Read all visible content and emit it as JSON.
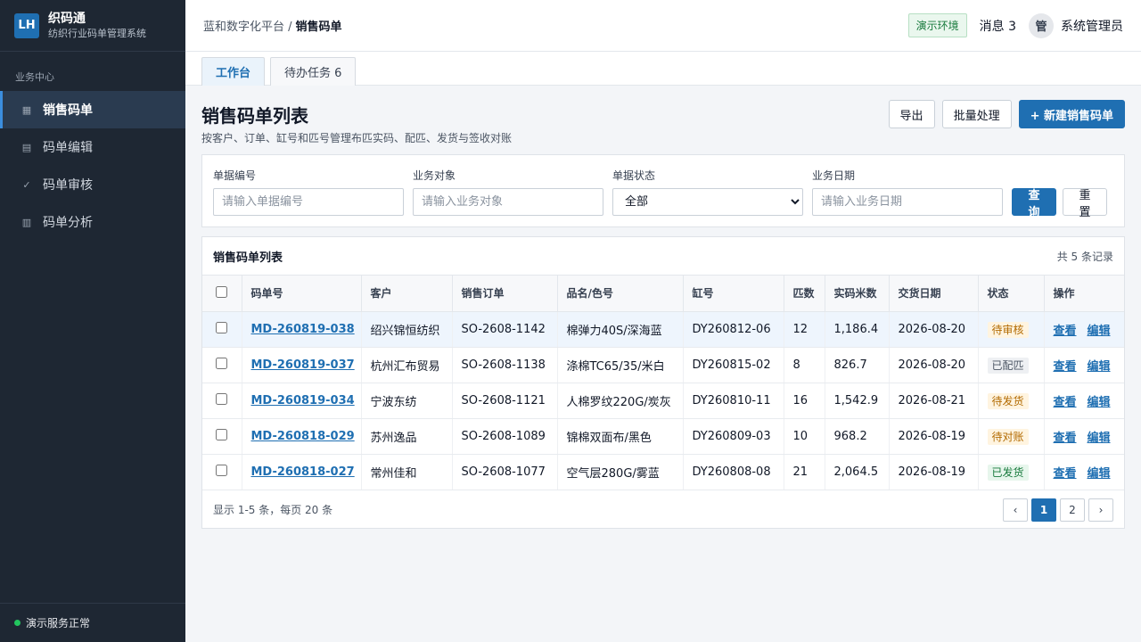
{
  "brand": {
    "logo": "LH",
    "name": "织码通",
    "subtitle": "纺织行业码单管理系统"
  },
  "sidebar": {
    "section": "业务中心",
    "items": [
      {
        "label": "销售码单",
        "icon": "grid-icon",
        "glyph": "▦",
        "active": true
      },
      {
        "label": "码单编辑",
        "icon": "edit-list-icon",
        "glyph": "▤",
        "active": false
      },
      {
        "label": "码单审核",
        "icon": "check-icon",
        "glyph": "✓",
        "active": false
      },
      {
        "label": "码单分析",
        "icon": "chart-icon",
        "glyph": "▥",
        "active": false
      }
    ],
    "status": "演示服务正常"
  },
  "header": {
    "breadcrumb_parent": "蓝和数字化平台 /",
    "breadcrumb_current": "销售码单",
    "env_badge": "演示环境",
    "messages": "消息 3",
    "avatar": "管",
    "user": "系统管理员"
  },
  "tabs": [
    {
      "label": "工作台",
      "active": true
    },
    {
      "label": "待办任务 6",
      "active": false
    }
  ],
  "page": {
    "title": "销售码单列表",
    "description": "按客户、订单、缸号和匹号管理布匹实码、配匹、发货与签收对账",
    "export_label": "导出",
    "batch_label": "批量处理",
    "new_label": "+ 新建销售码单"
  },
  "filters": {
    "code_label": "单据编号",
    "code_placeholder": "请输入单据编号",
    "target_label": "业务对象",
    "target_placeholder": "请输入业务对象",
    "status_label": "单据状态",
    "status_value": "全部",
    "date_label": "业务日期",
    "date_placeholder": "请输入业务日期",
    "query_label": "查询",
    "reset_label": "重置"
  },
  "list": {
    "title": "销售码单列表",
    "count": "共 5 条记录",
    "columns": [
      "码单号",
      "客户",
      "销售订单",
      "品名/色号",
      "缸号",
      "匹数",
      "实码米数",
      "交货日期",
      "状态",
      "操作"
    ],
    "view_label": "查看",
    "edit_label": "编辑",
    "rows": [
      {
        "code": "MD-260819-038",
        "customer": "绍兴锦恒纺织",
        "order": "SO-2608-1142",
        "product": "棉弹力40S/深海蓝",
        "batch": "DY260812-06",
        "pieces": "12",
        "meters": "1,186.4",
        "date": "2026-08-20",
        "status": "待审核",
        "status_color": "warn"
      },
      {
        "code": "MD-260819-037",
        "customer": "杭州汇布贸易",
        "order": "SO-2608-1138",
        "product": "涤棉TC65/35/米白",
        "batch": "DY260815-02",
        "pieces": "8",
        "meters": "826.7",
        "date": "2026-08-20",
        "status": "已配匹",
        "status_color": "gray"
      },
      {
        "code": "MD-260819-034",
        "customer": "宁波东纺",
        "order": "SO-2608-1121",
        "product": "人棉罗纹220G/炭灰",
        "batch": "DY260810-11",
        "pieces": "16",
        "meters": "1,542.9",
        "date": "2026-08-21",
        "status": "待发货",
        "status_color": "warn"
      },
      {
        "code": "MD-260818-029",
        "customer": "苏州逸品",
        "order": "SO-2608-1089",
        "product": "锦棉双面布/黑色",
        "batch": "DY260809-03",
        "pieces": "10",
        "meters": "968.2",
        "date": "2026-08-19",
        "status": "待对账",
        "status_color": "warn"
      },
      {
        "code": "MD-260818-027",
        "customer": "常州佳和",
        "order": "SO-2608-1077",
        "product": "空气层280G/雾蓝",
        "batch": "DY260808-08",
        "pieces": "21",
        "meters": "2,064.5",
        "date": "2026-08-19",
        "status": "已发货",
        "status_color": "green"
      }
    ]
  },
  "pager": {
    "info": "显示 1-5 条，每页 20 条",
    "prev": "‹",
    "pages": [
      "1",
      "2"
    ],
    "current": "1",
    "next": "›"
  }
}
